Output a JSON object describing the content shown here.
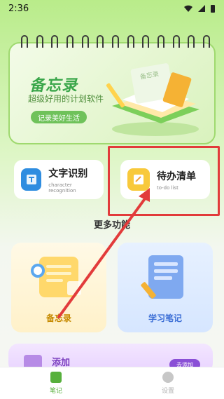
{
  "status": {
    "time": "2:36"
  },
  "banner": {
    "title": "备忘录",
    "subtitle": "超级好用的计划软件",
    "pill": "记录美好生活",
    "paper_label": "备忘录"
  },
  "features": [
    {
      "title": "文字识别",
      "subtitle": "character recognition"
    },
    {
      "title": "待办清单",
      "subtitle": "to-do list"
    }
  ],
  "more": {
    "title": "更多功能",
    "tiles": [
      {
        "label": "备忘录"
      },
      {
        "label": "学习笔记"
      }
    ],
    "add": {
      "label": "添加",
      "button": "去添加"
    }
  },
  "nav": {
    "notes": "笔记",
    "settings": "设置"
  },
  "colors": {
    "accent": "#57b03c",
    "annotation": "#e23b3b"
  }
}
